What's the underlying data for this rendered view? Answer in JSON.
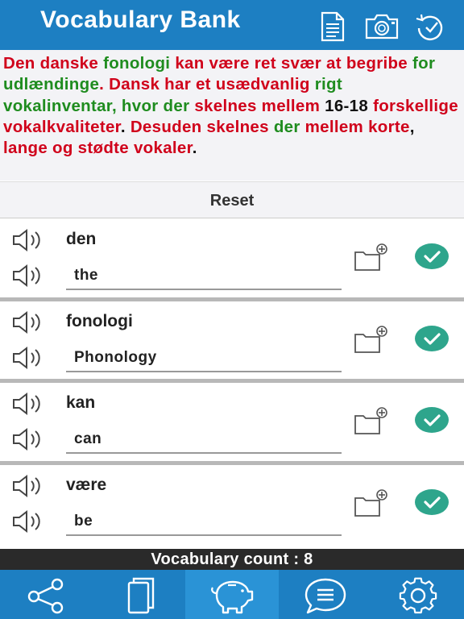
{
  "app": {
    "title": "Vocabulary Bank"
  },
  "header_icons": [
    "document-icon",
    "camera-icon",
    "history-icon"
  ],
  "passage": [
    {
      "text": "Den danske",
      "color": "#d0021b"
    },
    {
      "text": "fonologi",
      "color": "#1f8c1f"
    },
    {
      "text": "kan være ret svær at begribe",
      "color": "#d0021b"
    },
    {
      "text": "for udlændinge",
      "color": "#1f8c1f"
    },
    {
      "text": ".",
      "color": "#d0021b"
    },
    {
      "text": "Dansk har et usædvanlig",
      "color": "#d0021b"
    },
    {
      "text": "rigt vokalinventar, hvor der",
      "color": "#1f8c1f"
    },
    {
      "text": "skelnes mellem",
      "color": "#d0021b"
    },
    {
      "text": "16-18",
      "color": "#111111"
    },
    {
      "text": "forskellige vokalkvaliteter",
      "color": "#d0021b"
    },
    {
      "text": ".",
      "color": "#111111"
    },
    {
      "text": "Desuden skelnes",
      "color": "#d0021b"
    },
    {
      "text": "der",
      "color": "#1f8c1f"
    },
    {
      "text": "mellem korte",
      "color": "#d0021b"
    },
    {
      "text": ",",
      "color": "#111111"
    },
    {
      "text": "lange og stødte vokaler",
      "color": "#d0021b"
    },
    {
      "text": ".",
      "color": "#111111"
    }
  ],
  "reset_label": "Reset",
  "vocab": [
    {
      "word": "den",
      "translation": "the"
    },
    {
      "word": "fonologi",
      "translation": "Phonology"
    },
    {
      "word": "kan",
      "translation": "can"
    },
    {
      "word": "være",
      "translation": "be"
    }
  ],
  "count_label": "Vocabulary count : 8",
  "tabs": [
    {
      "icon": "share-icon",
      "active": false
    },
    {
      "icon": "cards-icon",
      "active": false
    },
    {
      "icon": "piggy-bank-icon",
      "active": true
    },
    {
      "icon": "chat-icon",
      "active": false
    },
    {
      "icon": "settings-icon",
      "active": false
    }
  ],
  "colors": {
    "header": "#1d7fc2",
    "check": "#2ea58c",
    "count_bar": "#2a2a2a"
  }
}
